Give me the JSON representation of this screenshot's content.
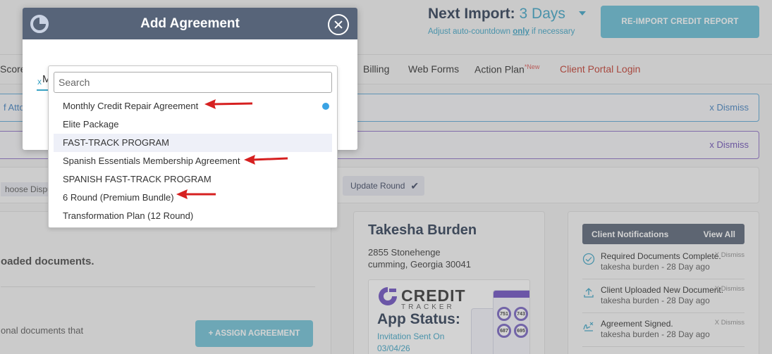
{
  "header": {
    "next_import_label": "Next Import:",
    "next_import_value": "3 Days",
    "adjust_prefix": "Adjust auto-countdown",
    "adjust_only": "only",
    "adjust_suffix": "if necessary",
    "reimport_button": "RE-IMPORT CREDIT REPORT"
  },
  "tabs": [
    "Score",
    "Billing",
    "Web Forms",
    "Action Plan",
    "Client Portal Login"
  ],
  "tab_new_badge": "*New",
  "alerts": {
    "blue_left": "f Atto",
    "dismiss": "x Dismiss"
  },
  "rounds": {
    "choose_label": "hoose Dispute",
    "update_round": "Update Round"
  },
  "left_panel": {
    "loaded_text": "oaded documents.",
    "onal_text": "onal documents that",
    "assign_button": "+ ASSIGN AGREEMENT"
  },
  "client": {
    "name": "Takesha Burden",
    "address_line1": "2855 Stonehenge",
    "address_line2": "cumming, Georgia 30041",
    "app_brand_top": "CREDIT",
    "app_brand_bottom": "TRACKER",
    "app_status_label": "App Status:",
    "invite_line1": "Invitation Sent On",
    "invite_line2": "03/04/26",
    "gauges": [
      "751",
      "743",
      "687",
      "695"
    ]
  },
  "notifications": {
    "title": "Client Notifications",
    "view_all": "View All",
    "dismiss_label": "X Dismiss",
    "items": [
      {
        "title": "Required Documents Complete.",
        "sub": "takesha burden - 28 Day ago"
      },
      {
        "title": "Client Uploaded New Document.",
        "sub": "takesha burden - 28 Day ago"
      },
      {
        "title": "Agreement Signed.",
        "sub": "takesha burden - 28 Day ago"
      }
    ]
  },
  "modal": {
    "title": "Add Agreement",
    "tag_x": "x",
    "tag_text": "M"
  },
  "dropdown": {
    "search_placeholder": "Search",
    "options": [
      "Monthly Credit Repair Agreement",
      "Elite Package",
      "FAST-TRACK PROGRAM",
      "Spanish Essentials Membership Agreement",
      "SPANISH FAST-TRACK PROGRAM",
      "6 Round (Premium Bundle)",
      "Transformation Plan (12 Round)"
    ],
    "highlighted_index": 2
  },
  "colors": {
    "accent": "#3aa3c4",
    "header_dark": "#576479",
    "annotation_arrow": "#d62020"
  }
}
